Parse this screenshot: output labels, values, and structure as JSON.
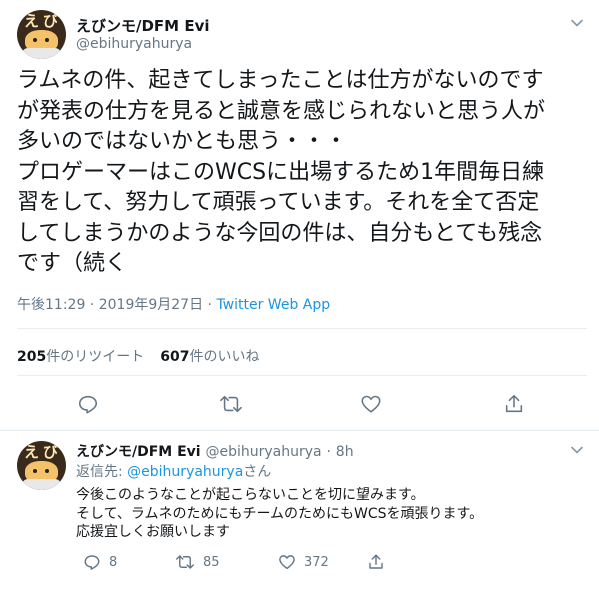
{
  "main": {
    "display_name": "えびンモ/DFM Evi",
    "handle": "@ebihuryahurya",
    "body_lines": [
      "ラムネの件、起きてしまったことは仕方がないのです",
      "が発表の仕方を見ると誠意を感じられないと思う人が",
      "多いのではないかとも思う・・・",
      "プロゲーマーはこのWCSに出場するため1年間毎日練",
      "習をして、努力して頑張っています。それを全て否定",
      "してしまうかのような今回の件は、自分もとても残念",
      "です（続く"
    ],
    "time": "午後11:29",
    "date": "2019年9月27日",
    "meta_sep": "·",
    "app": "Twitter Web App",
    "retweet_count": "205",
    "retweet_label": "件のリツイート",
    "like_count": "607",
    "like_label": "件のいいね"
  },
  "reply": {
    "display_name": "えびンモ/DFM Evi",
    "handle": "@ebihuryahurya",
    "age_sep": "·",
    "age": "8h",
    "replyto_prefix": "返信先:",
    "replyto_mention": "@ebihuryahurya",
    "replyto_suffix": "さん",
    "body_lines": [
      "今後このようなことが起こらないことを切に望みます。",
      "そして、ラムネのためにもチームのためにもWCSを頑張ります。",
      "応援宜しくお願いします"
    ],
    "reply_count": "8",
    "retweet_count": "85",
    "like_count": "372"
  },
  "avatar_text": "えび",
  "icons": {
    "reply": "reply-icon",
    "retweet": "retweet-icon",
    "like": "heart-icon",
    "share": "share-icon",
    "caret": "chevron-down-icon"
  },
  "colors": {
    "accent": "#1b95e0",
    "muted": "#657786",
    "text": "#14171a",
    "divider": "#e6ecf0"
  }
}
